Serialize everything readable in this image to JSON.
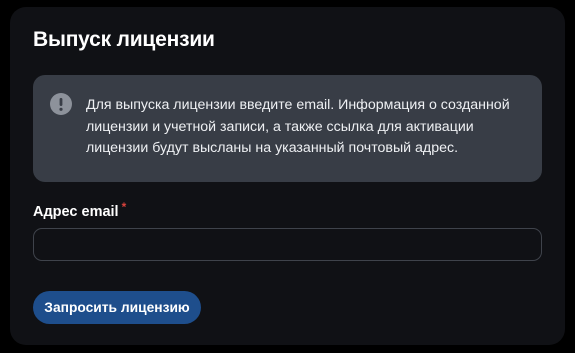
{
  "dialog": {
    "title": "Выпуск лицензии",
    "info_icon": "exclamation-circle-icon",
    "info_text": "Для выпуска лицензии введите email. Информация о созданной лицензии и учетной записи, а также ссылка для активации лицензии будут высланы на указанный почтовый адрес.",
    "email_label": "Адрес email",
    "required_mark": "*",
    "email_value": "",
    "email_placeholder": "",
    "submit_label": "Запросить лицензию"
  },
  "colors": {
    "background": "#000000",
    "card": "#101115",
    "info_box": "#383d46",
    "accent_button": "#1e4e8c",
    "required": "#d9423c",
    "input_border": "#3f434b"
  }
}
